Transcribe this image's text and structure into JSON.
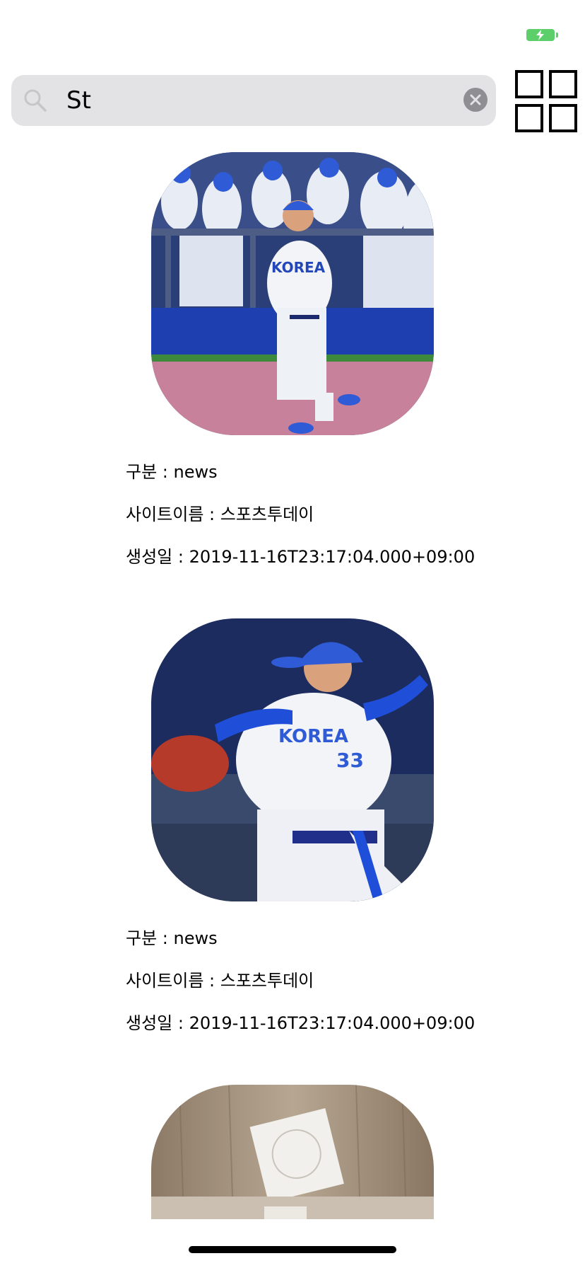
{
  "search": {
    "value": "St",
    "placeholder": ""
  },
  "colors": {
    "battery": "#5ccf6a",
    "search_background": "#e3e3e5",
    "clear_button": "#8e8e93"
  },
  "feed": [
    {
      "image": "baseball-manager-korea-photo",
      "category": "구분 : news",
      "site": "사이트이름 : 스포츠투데이",
      "created": "생성일 : 2019-11-16T23:17:04.000+09:00"
    },
    {
      "image": "baseball-pitcher-korea-photo",
      "category": "구분 : news",
      "site": "사이트이름 : 스포츠투데이",
      "created": "생성일 : 2019-11-16T23:17:04.000+09:00"
    },
    {
      "image": "gift-box-photo"
    }
  ]
}
